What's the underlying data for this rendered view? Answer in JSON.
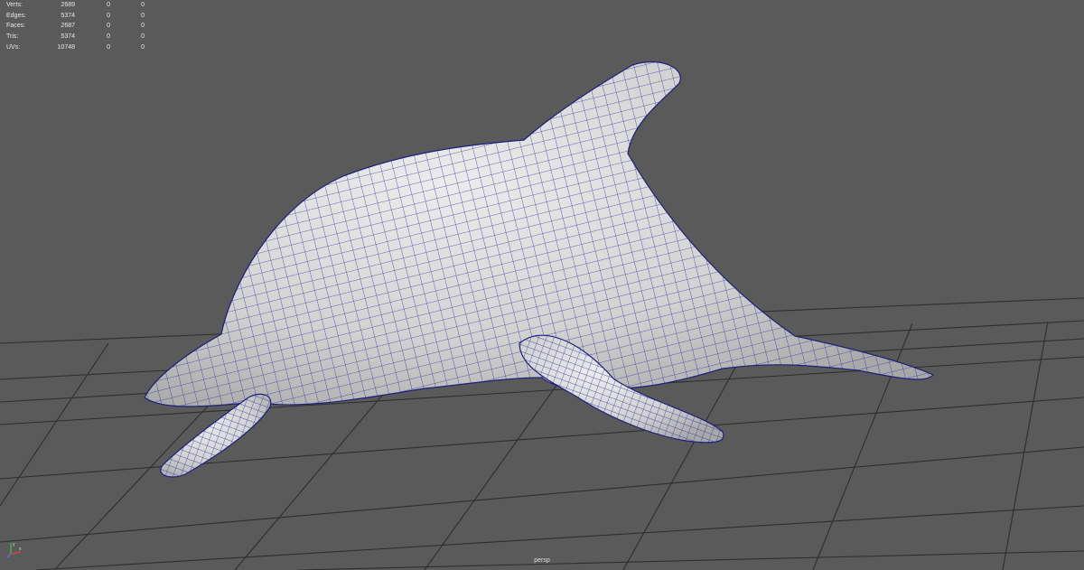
{
  "viewport": {
    "camera_label": "persp"
  },
  "hud": {
    "rows": [
      {
        "label": "Verts:",
        "v1": "2689",
        "v2": "0",
        "v3": "0"
      },
      {
        "label": "Edges:",
        "v1": "5374",
        "v2": "0",
        "v3": "0"
      },
      {
        "label": "Faces:",
        "v1": "2687",
        "v2": "0",
        "v3": "0"
      },
      {
        "label": "Tris:",
        "v1": "5374",
        "v2": "0",
        "v3": "0"
      },
      {
        "label": "UVs:",
        "v1": "10748",
        "v2": "0",
        "v3": "0"
      }
    ]
  },
  "axis_gizmo": {
    "x_color": "#e04040",
    "y_color": "#40c040",
    "z_color": "#4080ff",
    "x_label": "x",
    "y_label": "y"
  },
  "colors": {
    "background": "#5a5a5a",
    "grid": "#2e2e2e",
    "mesh_fill": "#d6d6d6",
    "wireframe": "#2b2c9a"
  }
}
